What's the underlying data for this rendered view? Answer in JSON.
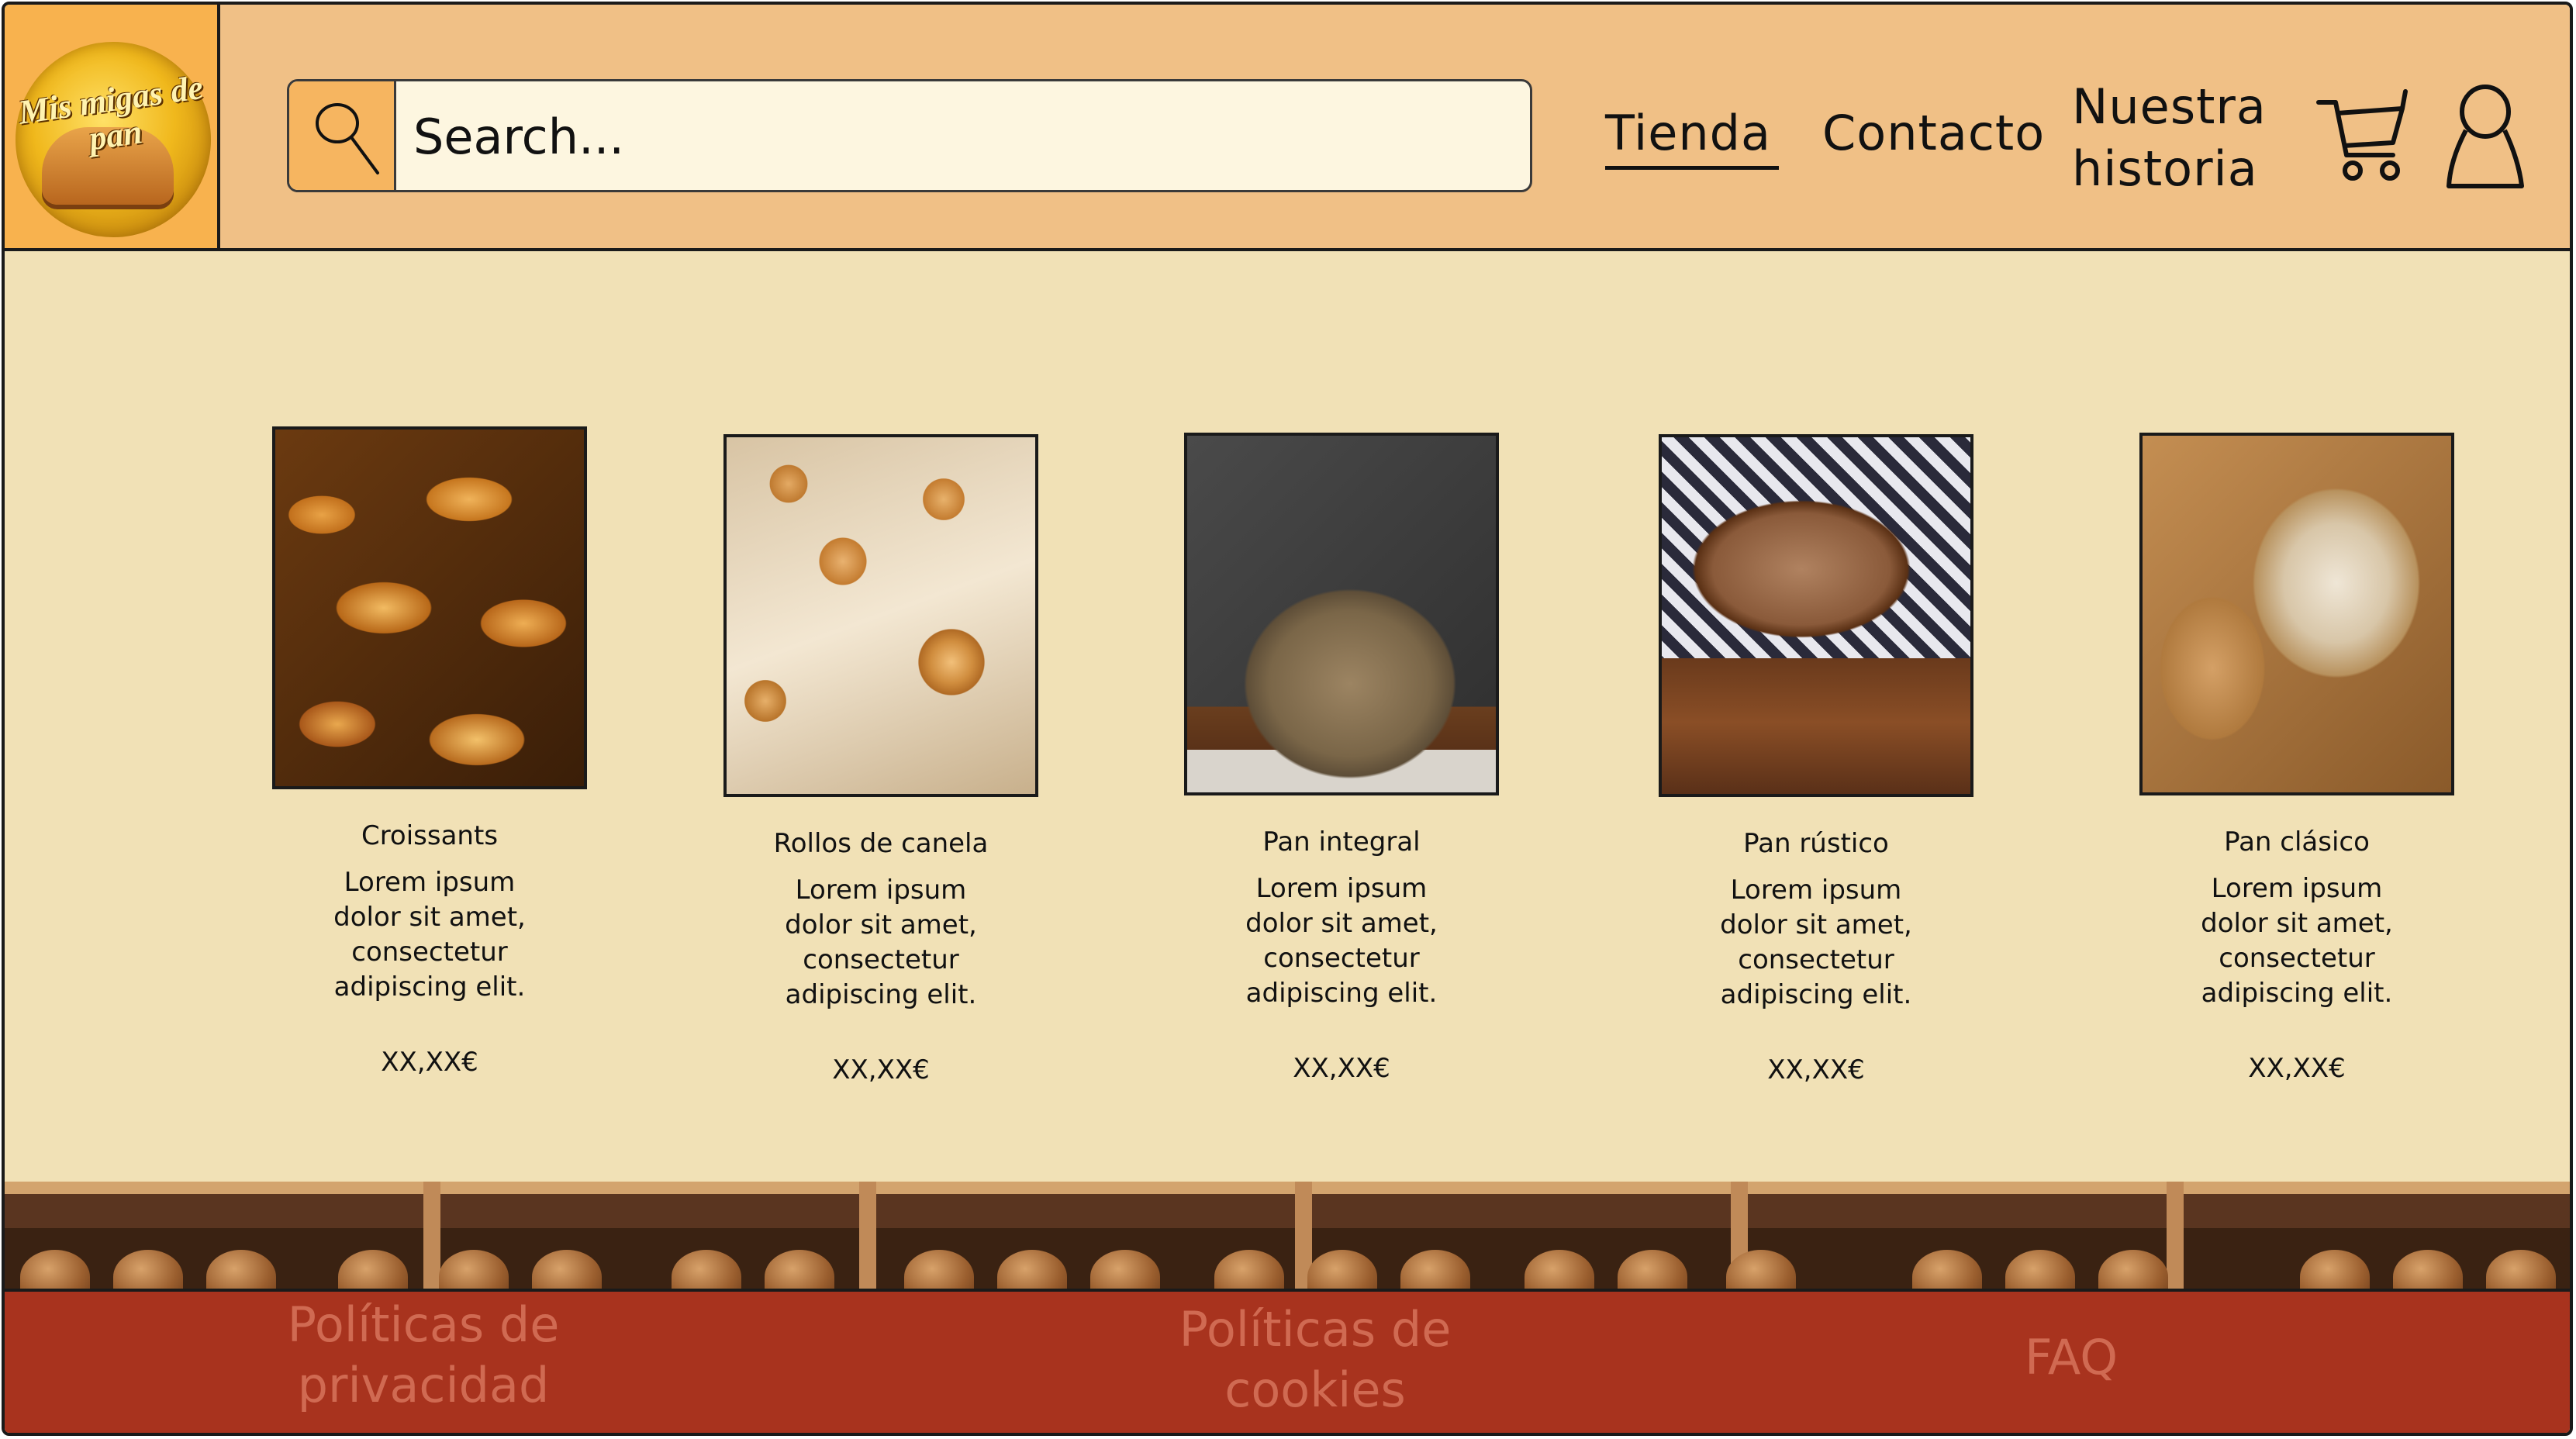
{
  "header": {
    "logo_text": "Mis migas de pan",
    "search_placeholder": "Search...",
    "nav": {
      "tienda": "Tienda",
      "contacto": "Contacto",
      "historia": "Nuestra historia"
    },
    "icons": [
      "search-icon",
      "cart-icon",
      "user-icon"
    ]
  },
  "products": [
    {
      "name": "Croissants",
      "description": "Lorem ipsum dolor sit amet, consectetur adipiscing elit.",
      "price": "XX,XX€",
      "image": "croissants"
    },
    {
      "name": "Rollos de canela",
      "description": "Lorem ipsum dolor sit amet, consectetur adipiscing elit.",
      "price": "XX,XX€",
      "image": "cinnamon-rolls"
    },
    {
      "name": "Pan integral",
      "description": "Lorem ipsum dolor sit amet, consectetur adipiscing elit.",
      "price": "XX,XX€",
      "image": "whole-wheat-bread"
    },
    {
      "name": "Pan rústico",
      "description": "Lorem ipsum dolor sit amet, consectetur adipiscing elit.",
      "price": "XX,XX€",
      "image": "rustic-bread"
    },
    {
      "name": "Pan clásico",
      "description": "Lorem ipsum dolor sit amet, consectetur adipiscing elit.",
      "price": "XX,XX€",
      "image": "classic-bread"
    }
  ],
  "footer": {
    "privacy": "Políticas de privacidad",
    "cookies": "Políticas de cookies",
    "faq": "FAQ"
  },
  "colors": {
    "header_bg": "#f0c086",
    "page_bg": "#f1e1b6",
    "footer_bg": "#a8331e",
    "footer_text": "#d06a52",
    "logo_box": "#f8b24e"
  }
}
